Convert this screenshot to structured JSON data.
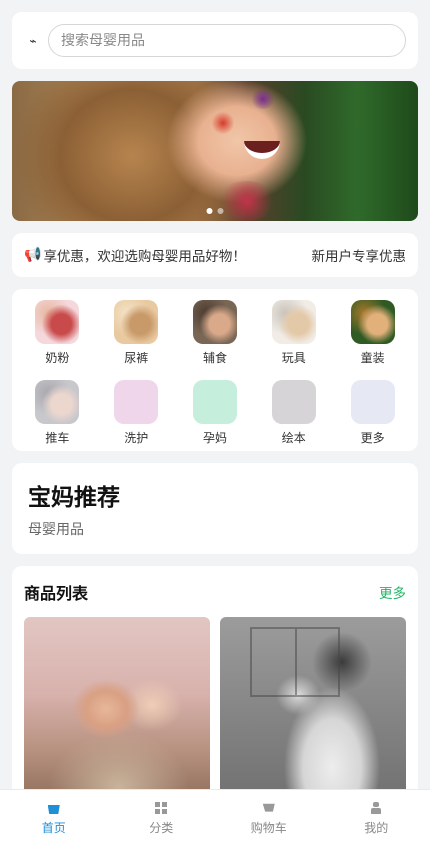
{
  "search": {
    "placeholder": "搜索母婴用品",
    "scan_icon": "scan-icon"
  },
  "banner": {
    "slide_count": 2,
    "active_index": 0
  },
  "notice": {
    "icon": "megaphone-icon",
    "text": "享优惠，欢迎选购母婴用品好物！",
    "link": "新用户专享优惠"
  },
  "categories": [
    {
      "label": "奶粉",
      "colors": [
        "#f4d8dc",
        "#c94a4a",
        "#e8b7a0"
      ]
    },
    {
      "label": "尿裤",
      "colors": [
        "#e9c9a0",
        "#c89a6a",
        "#f3e2c6"
      ]
    },
    {
      "label": "辅食",
      "colors": [
        "#7a6655",
        "#d9a98a",
        "#4b3b30"
      ]
    },
    {
      "label": "玩具",
      "colors": [
        "#f1ece6",
        "#e4c9a8",
        "#c9c3bb"
      ]
    },
    {
      "label": "童装",
      "colors": [
        "#2f5a23",
        "#e2b07a",
        "#a8782c"
      ]
    },
    {
      "label": "推车",
      "colors": [
        "#c7c7cc",
        "#ecd7cf",
        "#a7a7ad"
      ]
    },
    {
      "label": "洗护",
      "colors": [
        "#efd6ea",
        "#efd6ea",
        "#efd6ea"
      ]
    },
    {
      "label": "孕妈",
      "colors": [
        "#c6eedd",
        "#c6eedd",
        "#c6eedd"
      ]
    },
    {
      "label": "绘本",
      "colors": [
        "#d6d4d6",
        "#d6d4d6",
        "#d6d4d6"
      ]
    },
    {
      "label": "更多",
      "colors": [
        "#e6e9f4",
        "#e6e9f4",
        "#e6e9f4"
      ]
    }
  ],
  "promo": {
    "title": "宝妈推荐",
    "subtitle": "母婴用品"
  },
  "products": {
    "title": "商品列表",
    "more": "更多"
  },
  "tabbar": [
    {
      "label": "首页",
      "icon": "home-icon",
      "active": true
    },
    {
      "label": "分类",
      "icon": "grid-icon",
      "active": false
    },
    {
      "label": "购物车",
      "icon": "cart-icon",
      "active": false
    },
    {
      "label": "我的",
      "icon": "user-icon",
      "active": false
    }
  ],
  "colors": {
    "accent": "#1f8fd6",
    "more_link": "#22b566",
    "background": "#f2f3f5"
  }
}
